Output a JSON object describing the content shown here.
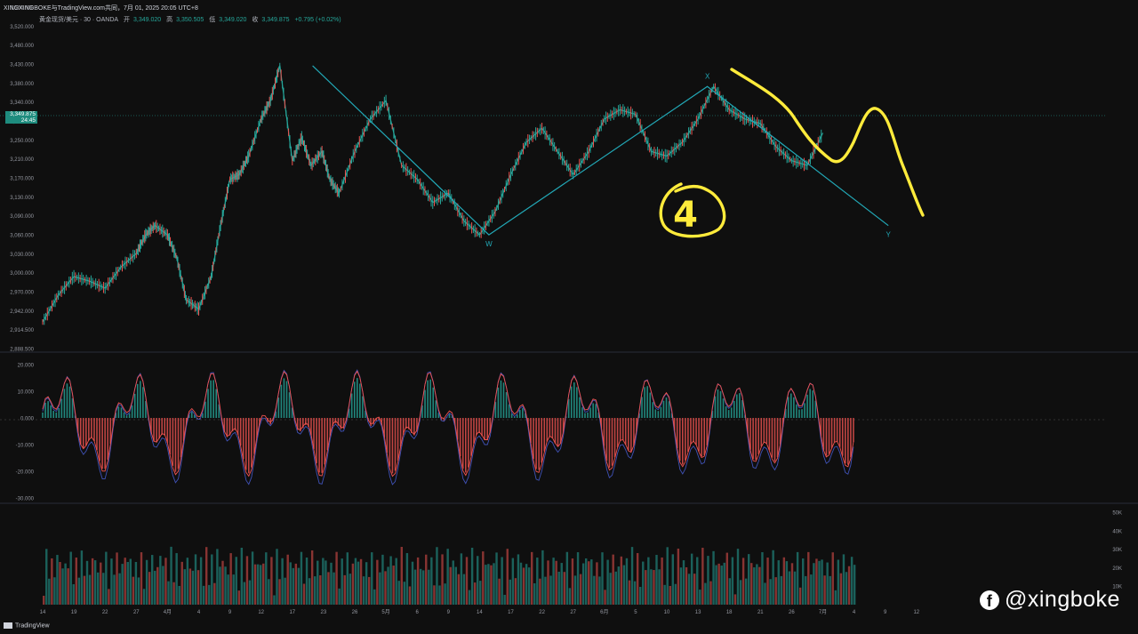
{
  "header": {
    "title": "XINGXINGBOKE与TradingView.com共同，7月 01, 2025 20:05 UTC+8"
  },
  "legend": {
    "symbol": "黄金现货/美元 · 30 · OANDA",
    "open_label": "开",
    "open": "3,349.020",
    "high_label": "高",
    "high": "3,350.505",
    "low_label": "低",
    "low": "3,349.020",
    "close_label": "收",
    "close": "3,349.875",
    "change": "+0.795 (+0.02%)"
  },
  "price_tag": {
    "price": "3,349.875",
    "countdown": "24:45"
  },
  "footer": {
    "brand": "TradingView"
  },
  "watermark": {
    "handle": "@xingboke",
    "icon": "facebook-icon"
  },
  "annotations": {
    "wave_number": "4",
    "wave_labels": [
      "X",
      "W",
      "Y"
    ]
  },
  "colors": {
    "background": "#0f0f0f",
    "up": "#26a69a",
    "down": "#ef5350",
    "wave_line": "#22a8b6",
    "highlight": "#ffeb3b",
    "oscillator_line_1": "#3f51b5",
    "oscillator_line_2": "#ef5350"
  },
  "chart_data": [
    {
      "type": "line",
      "symbol": "黄金现货/美元 · 30 · OANDA",
      "ylim": [
        2888.5,
        3560
      ],
      "y_ticks": [
        "3,560.000",
        "3,520.000",
        "3,480.000",
        "3,430.000",
        "3,380.000",
        "3,340.000",
        "3,290.000",
        "3,250.000",
        "3,210.000",
        "3,170.000",
        "3,130.000",
        "3,090.000",
        "3,060.000",
        "3,030.000",
        "3,000.000",
        "2,970.000",
        "2,942.000",
        "2,914.500",
        "2,888.500"
      ],
      "x_ticks": [
        "14",
        "19",
        "22",
        "27",
        "4月",
        "4",
        "9",
        "12",
        "17",
        "23",
        "26",
        "5月",
        "6",
        "9",
        "14",
        "17",
        "22",
        "27",
        "6月",
        "5",
        "10",
        "13",
        "18",
        "21",
        "26",
        "7月",
        "4",
        "9",
        "12"
      ],
      "x_tick_idx": [
        0,
        1,
        2,
        3,
        4,
        5,
        6,
        7,
        8,
        9,
        10,
        11,
        12,
        13,
        14,
        15,
        16,
        17,
        18,
        19,
        20,
        21,
        22,
        23,
        24,
        25,
        26,
        27,
        28
      ],
      "series": [
        {
          "x": [
            0,
            0.5,
            1,
            1.5,
            2,
            2.5,
            3,
            3.3,
            3.6,
            4,
            4.3,
            4.6,
            5,
            5.4,
            5.7,
            6,
            6.3,
            6.6,
            7,
            7.3,
            7.6,
            8,
            8.3,
            8.6,
            8.95,
            9.2,
            9.5,
            10,
            10.5,
            11,
            11.5,
            12,
            12.5,
            13,
            13.5,
            14,
            14.5,
            15,
            15.5,
            16,
            16.5,
            17,
            17.5,
            18,
            18.5,
            19,
            19.5,
            20,
            20.5,
            21,
            21.5,
            22,
            22.5,
            23,
            23.5,
            24,
            24.5,
            25
          ],
          "y": [
            2942,
            3000,
            3040,
            3030,
            3015,
            3060,
            3090,
            3130,
            3150,
            3130,
            3080,
            2990,
            2970,
            3040,
            3150,
            3250,
            3260,
            3300,
            3380,
            3420,
            3495,
            3290,
            3340,
            3280,
            3310,
            3250,
            3220,
            3310,
            3380,
            3420,
            3280,
            3250,
            3200,
            3220,
            3160,
            3130,
            3180,
            3260,
            3330,
            3360,
            3310,
            3260,
            3310,
            3380,
            3400,
            3390,
            3310,
            3300,
            3330,
            3380,
            3450,
            3400,
            3380,
            3370,
            3320,
            3290,
            3280,
            3350
          ]
        }
      ],
      "wave_points": [
        {
          "label": "",
          "x": 8.65,
          "y": 3495
        },
        {
          "label": "W",
          "x": 14.3,
          "y": 3130
        },
        {
          "label": "X",
          "x": 21.3,
          "y": 3450
        },
        {
          "label": "Y",
          "x": 27.1,
          "y": 3150
        }
      ]
    },
    {
      "type": "line",
      "ylim": [
        -30,
        20
      ],
      "y_ticks": [
        "20.000",
        "10.000",
        "0.000",
        "-10.000",
        "-20.000",
        "-30.000"
      ]
    },
    {
      "type": "bar",
      "ylim": [
        0,
        50
      ],
      "y_ticks": [
        "50K",
        "40K",
        "30K",
        "20K",
        "10K"
      ]
    }
  ]
}
